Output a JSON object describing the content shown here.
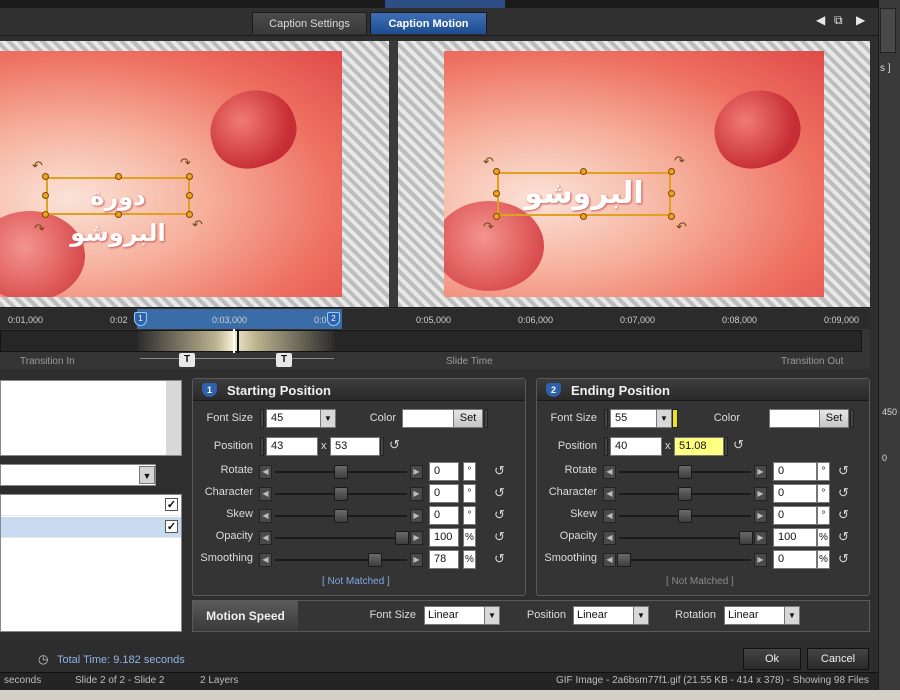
{
  "tabs": [
    {
      "label": "Caption Settings",
      "active": false
    },
    {
      "label": "Caption Motion",
      "active": true
    }
  ],
  "nav_icons": [
    "arrow-left-icon",
    "copy-icon",
    "arrow-right-icon"
  ],
  "preview": {
    "left_caption": "دورة البروشو",
    "right_caption": "البروشو"
  },
  "timeline": {
    "ticks": [
      "0:01,000",
      "0:02",
      "0:03,000",
      "0:0",
      "0:05,000",
      "0:06,000",
      "0:07,000",
      "0:08,000",
      "0:09,000"
    ],
    "marker_1": "1",
    "marker_2": "2",
    "transition_in": "Transition In",
    "slide_time": "Slide Time",
    "transition_out": "Transition Out"
  },
  "start": {
    "badge": "1",
    "title": "Starting Position",
    "font_size_label": "Font Size",
    "font_size": "45",
    "color_label": "Color",
    "set_label": "Set",
    "position_label": "Position",
    "pos_x": "43",
    "x_sep": "x",
    "pos_y": "53",
    "rotate_label": "Rotate",
    "rotate": "0",
    "rotate_unit": "°",
    "character_label": "Character",
    "character": "0",
    "character_unit": "°",
    "skew_label": "Skew",
    "skew": "0",
    "skew_unit": "°",
    "opacity_label": "Opacity",
    "opacity": "100",
    "opacity_unit": "%",
    "smoothing_label": "Smoothing",
    "smoothing": "78",
    "smoothing_unit": "%",
    "not_matched": "[ Not Matched ]"
  },
  "end": {
    "badge": "2",
    "title": "Ending Position",
    "font_size_label": "Font Size",
    "font_size": "55",
    "color_label": "Color",
    "set_label": "Set",
    "position_label": "Position",
    "pos_x": "40",
    "x_sep": "x",
    "pos_y": "51.08",
    "rotate_label": "Rotate",
    "rotate": "0",
    "rotate_unit": "°",
    "character_label": "Character",
    "character": "0",
    "character_unit": "°",
    "skew_label": "Skew",
    "skew": "0",
    "skew_unit": "°",
    "opacity_label": "Opacity",
    "opacity": "100",
    "opacity_unit": "%",
    "smoothing_label": "Smoothing",
    "smoothing": "0",
    "smoothing_unit": "%",
    "not_matched": "[ Not Matched ]"
  },
  "sliders": {
    "start": {
      "rotate": 0.5,
      "character": 0.5,
      "skew": 0.5,
      "opacity": 1.0,
      "smoothing": 0.78
    },
    "end": {
      "rotate": 0.5,
      "character": 0.5,
      "skew": 0.5,
      "opacity": 1.0,
      "smoothing": 0.0
    }
  },
  "motion_speed": {
    "title": "Motion Speed",
    "font_size_label": "Font Size",
    "font_size": "Linear",
    "position_label": "Position",
    "position": "Linear",
    "rotation_label": "Rotation",
    "rotation": "Linear"
  },
  "footer": {
    "total_time": "Total Time: 9.182 seconds",
    "ok": "Ok",
    "cancel": "Cancel"
  },
  "status_bar": {
    "seconds": "seconds",
    "slide": "Slide 2 of 2 - Slide 2",
    "layers": "2 Layers",
    "image": "GIF Image - 2a6bsm77f1.gif (21.55 KB - 414 x 378) - Showing 98 Files"
  },
  "right_edge": {
    "bracket": "s ]",
    "num_450": "450",
    "num_0": "0"
  },
  "colors": {
    "accent": "#2f62ad",
    "highlight_input": "#ffff80",
    "caption_border": "#e0a020"
  }
}
